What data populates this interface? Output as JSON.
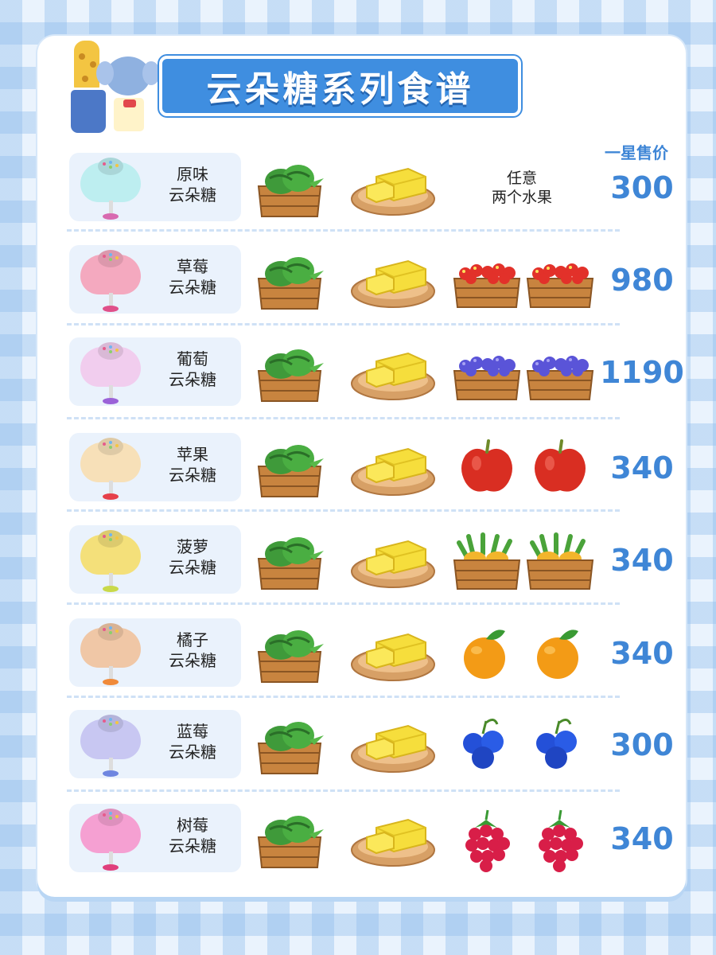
{
  "title": "云朵糖系列食谱",
  "price_header": "一星售价",
  "icons": {
    "melon_crate": "watermelon-crate-icon",
    "butter": "butter-plate-icon"
  },
  "recipes": [
    {
      "name_line1": "原味",
      "name_line2": "云朵糖",
      "color": "#bdeef0",
      "base_color": "#d86ab0",
      "fruit": "any",
      "any_line1": "任意",
      "any_line2": "两个水果",
      "price": "300"
    },
    {
      "name_line1": "草莓",
      "name_line2": "云朵糖",
      "color": "#f4a9bf",
      "base_color": "#e0508a",
      "fruit": "strawberry-crate",
      "price": "980"
    },
    {
      "name_line1": "葡萄",
      "name_line2": "云朵糖",
      "color": "#f1cdee",
      "base_color": "#9b62d8",
      "fruit": "grape-crate",
      "price": "1190"
    },
    {
      "name_line1": "苹果",
      "name_line2": "云朵糖",
      "color": "#f7e0b8",
      "base_color": "#e6404a",
      "fruit": "apple",
      "price": "340"
    },
    {
      "name_line1": "菠萝",
      "name_line2": "云朵糖",
      "color": "#f4e07a",
      "base_color": "#c9d94a",
      "fruit": "pineapple-crate",
      "price": "340"
    },
    {
      "name_line1": "橘子",
      "name_line2": "云朵糖",
      "color": "#f0c7a6",
      "base_color": "#f08a3a",
      "fruit": "orange",
      "price": "340"
    },
    {
      "name_line1": "蓝莓",
      "name_line2": "云朵糖",
      "color": "#c8c7f2",
      "base_color": "#6f86e0",
      "fruit": "blueberry",
      "price": "300"
    },
    {
      "name_line1": "树莓",
      "name_line2": "云朵糖",
      "color": "#f5a0d2",
      "base_color": "#e03f7c",
      "fruit": "raspberry",
      "price": "340"
    }
  ]
}
